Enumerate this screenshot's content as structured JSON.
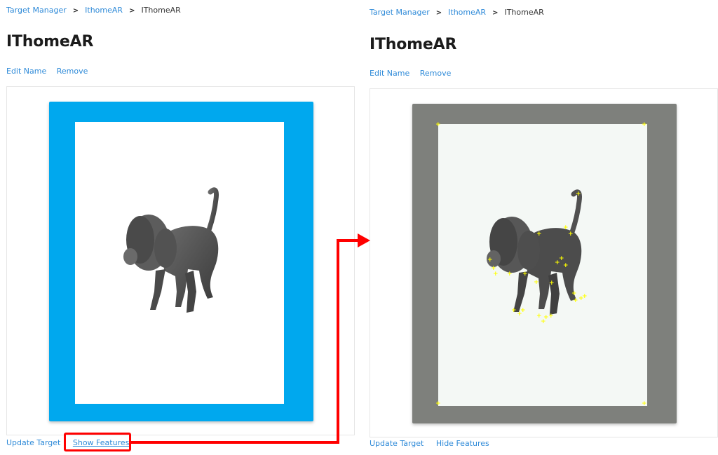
{
  "left": {
    "breadcrumb": {
      "root": "Target Manager",
      "db": "IthomeAR",
      "current": "IThomeAR"
    },
    "title": "IThomeAR",
    "actions": {
      "edit": "Edit Name",
      "remove": "Remove"
    },
    "bottom": {
      "update": "Update Target",
      "features": "Show Features"
    }
  },
  "right": {
    "breadcrumb": {
      "root": "Target Manager",
      "db": "IthomeAR",
      "current": "IThomeAR"
    },
    "title": "IThomeAR",
    "actions": {
      "edit": "Edit Name",
      "remove": "Remove"
    },
    "bottom": {
      "update": "Update Target",
      "features": "Hide Features"
    }
  },
  "colors": {
    "link": "#2e8ad8",
    "frame_blue": "#00a8ee",
    "frame_gray": "#7e807c",
    "highlight": "#ff0000",
    "feature_marker": "#ffff00"
  },
  "icons": {
    "separator": "chevron-right-icon",
    "feature": "plus-marker-icon"
  }
}
